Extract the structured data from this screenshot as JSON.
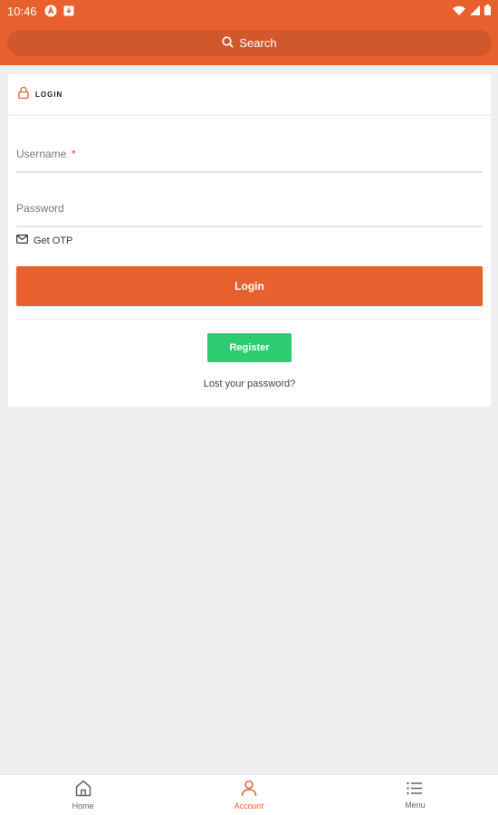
{
  "status_bar": {
    "time": "10:46"
  },
  "search": {
    "label": "Search"
  },
  "login_card": {
    "title": "LOGIN",
    "username_placeholder": "Username",
    "username_required_mark": "*",
    "password_placeholder": "Password",
    "otp_label": "Get OTP",
    "login_button": "Login",
    "register_button": "Register",
    "lost_password": "Lost your password?"
  },
  "bottom_nav": {
    "items": [
      {
        "label": "Home",
        "icon": "home-icon"
      },
      {
        "label": "Account",
        "icon": "account-icon",
        "active": true
      },
      {
        "label": "Menu",
        "icon": "menu-icon"
      }
    ]
  },
  "colors": {
    "brand": "#e8602d",
    "search_bg": "#d1582a",
    "register": "#2ecc71",
    "page_bg": "#efeff1"
  }
}
